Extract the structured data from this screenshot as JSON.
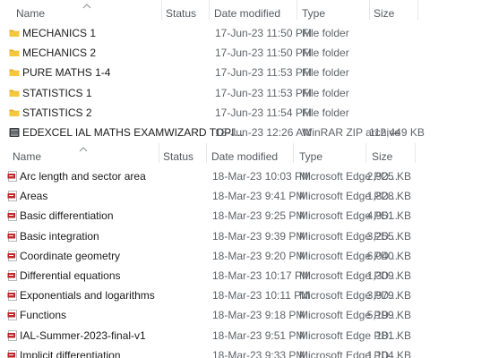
{
  "top_pane": {
    "columns": {
      "name": "Name",
      "status": "Status",
      "date_modified": "Date modified",
      "type": "Type",
      "size": "Size"
    },
    "rows": [
      {
        "name": "MECHANICS 1",
        "date": "17-Jun-23 11:50 PM",
        "type": "File folder",
        "size": "",
        "icon": "folder-icon"
      },
      {
        "name": "MECHANICS 2",
        "date": "17-Jun-23 11:50 PM",
        "type": "File folder",
        "size": "",
        "icon": "folder-icon"
      },
      {
        "name": "PURE MATHS 1-4",
        "date": "17-Jun-23 11:53 PM",
        "type": "File folder",
        "size": "",
        "icon": "folder-icon"
      },
      {
        "name": "STATISTICS 1",
        "date": "17-Jun-23 11:53 PM",
        "type": "File folder",
        "size": "",
        "icon": "folder-icon"
      },
      {
        "name": "STATISTICS 2",
        "date": "17-Jun-23 11:54 PM",
        "type": "File folder",
        "size": "",
        "icon": "folder-icon"
      },
      {
        "name": "EDEXCEL IAL MATHS EXAMWIZARD TOPI...",
        "date": "18-Jun-23 12:26 AM",
        "type": "WinRAR ZIP archive",
        "size": "112,449 KB",
        "icon": "zip-archive-icon"
      }
    ]
  },
  "bottom_pane": {
    "columns": {
      "name": "Name",
      "status": "Status",
      "date_modified": "Date modified",
      "type": "Type",
      "size": "Size"
    },
    "rows": [
      {
        "name": "Arc length and sector area",
        "date": "18-Mar-23 10:03 PM",
        "type": "Microsoft Edge PD...",
        "size": "2,925 KB",
        "icon": "pdf-icon"
      },
      {
        "name": "Areas",
        "date": "18-Mar-23 9:41 PM",
        "type": "Microsoft Edge PD...",
        "size": "1,828 KB",
        "icon": "pdf-icon"
      },
      {
        "name": "Basic differentiation",
        "date": "18-Mar-23 9:25 PM",
        "type": "Microsoft Edge PD...",
        "size": "4,951 KB",
        "icon": "pdf-icon"
      },
      {
        "name": "Basic integration",
        "date": "18-Mar-23 9:39 PM",
        "type": "Microsoft Edge PD...",
        "size": "3,255 KB",
        "icon": "pdf-icon"
      },
      {
        "name": "Coordinate geometry",
        "date": "18-Mar-23 9:20 PM",
        "type": "Microsoft Edge PD...",
        "size": "6,040 KB",
        "icon": "pdf-icon"
      },
      {
        "name": "Differential equations",
        "date": "18-Mar-23 10:17 PM",
        "type": "Microsoft Edge PD...",
        "size": "1,309 KB",
        "icon": "pdf-icon"
      },
      {
        "name": "Exponentials and logarithms",
        "date": "18-Mar-23 10:11 PM",
        "type": "Microsoft Edge PD...",
        "size": "3,979 KB",
        "icon": "pdf-icon"
      },
      {
        "name": "Functions",
        "date": "18-Mar-23 9:18 PM",
        "type": "Microsoft Edge PD...",
        "size": "5,199 KB",
        "icon": "pdf-icon"
      },
      {
        "name": "IAL-Summer-2023-final-v1",
        "date": "18-Mar-23 9:51 PM",
        "type": "Microsoft Edge PD...",
        "size": "181 KB",
        "icon": "pdf-icon"
      },
      {
        "name": "Implicit differentiation",
        "date": "18-Mar-23 9:33 PM",
        "type": "Microsoft Edge PD...",
        "size": "1,104 KB",
        "icon": "pdf-icon"
      }
    ]
  },
  "colors": {
    "folder": "#f5c83b",
    "folder_dark": "#e0a92a",
    "pdf_red": "#c3262b",
    "zip_dark": "#3d3d3d",
    "header_text": "#555a60",
    "separator": "#e4e6ea"
  }
}
